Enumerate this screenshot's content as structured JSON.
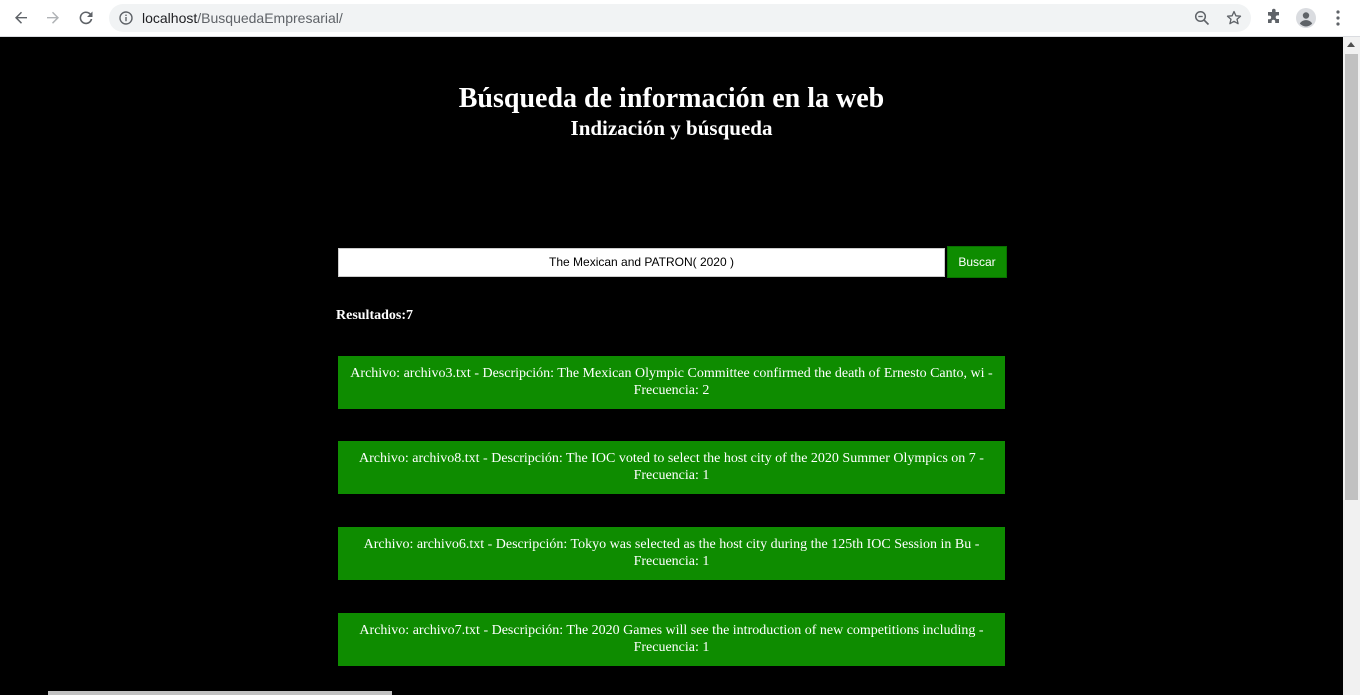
{
  "browser": {
    "url_host": "localhost",
    "url_path": "/BusquedaEmpresarial/"
  },
  "header": {
    "title": "Búsqueda de información en la web",
    "subtitle": "Indización y búsqueda"
  },
  "search": {
    "value": "The Mexican and PATRON( 2020 )",
    "button_label": "Buscar"
  },
  "results": {
    "label": "Resultados:7",
    "items": [
      {
        "text": "Archivo: archivo3.txt - Descripción: The Mexican Olympic Committee confirmed the death of Ernesto Canto, wi - Frecuencia: 2"
      },
      {
        "text": "Archivo: archivo8.txt - Descripción: The IOC voted to select the host city of the 2020 Summer Olympics on 7 - Frecuencia: 1"
      },
      {
        "text": "Archivo: archivo6.txt - Descripción: Tokyo was selected as the host city during the 125th IOC Session in Bu - Frecuencia: 1"
      },
      {
        "text": "Archivo: archivo7.txt - Descripción: The 2020 Games will see the introduction of new competitions including - Frecuencia: 1"
      }
    ]
  },
  "colors": {
    "page_background": "#000000",
    "accent_green": "#0e8c00"
  },
  "icons": [
    "back-arrow-icon",
    "forward-arrow-icon",
    "reload-icon",
    "info-icon",
    "zoom-icon",
    "star-icon",
    "extensions-icon",
    "profile-icon",
    "menu-icon"
  ]
}
